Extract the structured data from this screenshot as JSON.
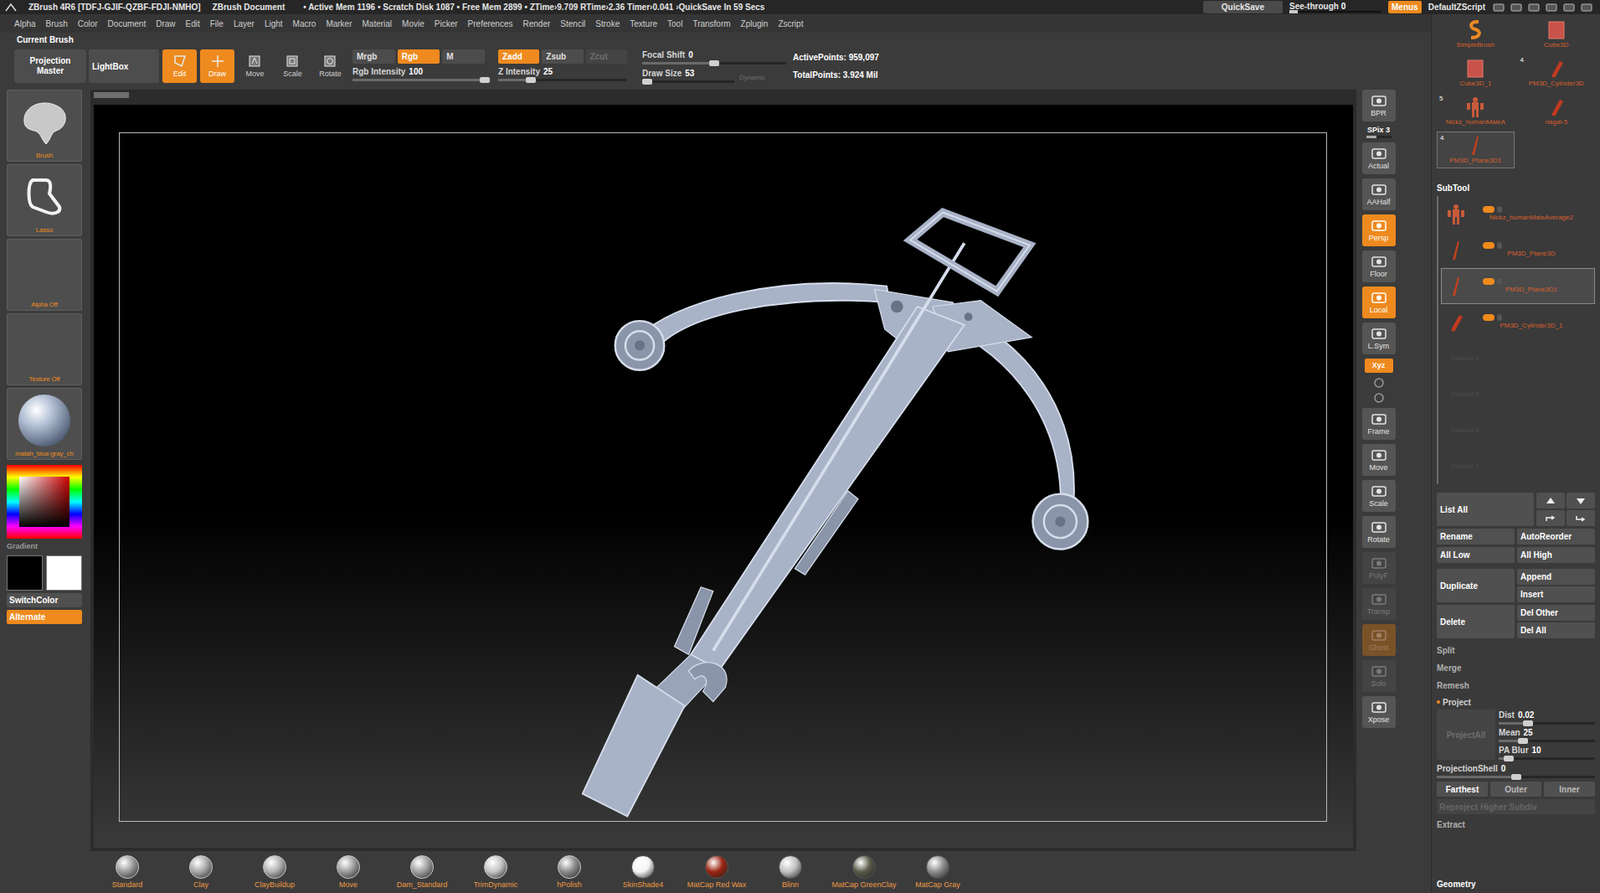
{
  "title_bar": {
    "app": "ZBrush 4R6 [TDFJ-GJIF-QZBF-FDJI-NMHO]",
    "document": "ZBrush Document",
    "stats": "• Active Mem 1196 • Scratch Disk 1087 • Free Mem 2899 • ZTime›9.709 RTime›2.36 Timer›0.041 ›QuickSave In 59 Secs",
    "quicksave": "QuickSave",
    "see_through": {
      "label": "See-through",
      "value": "0",
      "level": 0
    },
    "menus": {
      "label": "Menus",
      "selected": true
    },
    "script": "DefaultZScript"
  },
  "menu_bar": [
    "Alpha",
    "Brush",
    "Color",
    "Document",
    "Draw",
    "Edit",
    "File",
    "Layer",
    "Light",
    "Macro",
    "Marker",
    "Material",
    "Movie",
    "Picker",
    "Preferences",
    "Render",
    "Stencil",
    "Stroke",
    "Texture",
    "Tool",
    "Transform",
    "Zplugin",
    "Zscript"
  ],
  "current_brush": "Current Brush",
  "toolbar": {
    "projection_master": "Projection Master",
    "lightbox": "LightBox",
    "modes": [
      {
        "label": "Edit",
        "kind": "edit",
        "selected": true
      },
      {
        "label": "Draw",
        "kind": "draw",
        "selected": true
      },
      {
        "label": "Move",
        "kind": "move",
        "selected": false
      },
      {
        "label": "Scale",
        "kind": "scale",
        "selected": false
      },
      {
        "label": "Rotate",
        "kind": "rotate",
        "selected": false
      }
    ],
    "color_modes": [
      {
        "label": "Mrgb",
        "selected": false,
        "disabled": false
      },
      {
        "label": "Rgb",
        "selected": true,
        "disabled": false
      },
      {
        "label": "M",
        "selected": false,
        "disabled": false
      }
    ],
    "z_modes": [
      {
        "label": "Zadd",
        "selected": true,
        "disabled": false
      },
      {
        "label": "Zsub",
        "selected": false,
        "disabled": false
      },
      {
        "label": "Zcut",
        "selected": false,
        "disabled": true
      }
    ],
    "rgb_intensity": {
      "label": "Rgb Intensity",
      "value": "100",
      "level": 1
    },
    "z_intensity": {
      "label": "Z Intensity",
      "value": "25",
      "level": 0.25
    },
    "focal_shift": {
      "label": "Focal Shift",
      "value": "0",
      "level": 0.5
    },
    "draw_size": {
      "label": "Draw Size",
      "value": "53",
      "level": 0.05
    },
    "dynamic": {
      "label": "Dynamic",
      "selected": false
    },
    "active_points": "ActivePoints: 959,097",
    "total_points": "TotalPoints: 3.924 Mil"
  },
  "left_shelf": {
    "thumbnails": [
      {
        "label": "Brush",
        "kind": "brush"
      },
      {
        "label": "Lasso",
        "kind": "lasso"
      },
      {
        "label": "Alpha Off",
        "kind": "empty"
      },
      {
        "label": "Texture Off",
        "kind": "empty"
      },
      {
        "label": "matah_blue-gray_ch",
        "kind": "material"
      }
    ],
    "gradient": "Gradient",
    "swatches": [
      {
        "name": "secondary",
        "color": "#000000"
      },
      {
        "name": "main",
        "color": "#ffffff"
      }
    ],
    "switch_color": "SwitchColor",
    "alternate": {
      "label": "Alternate",
      "selected": true
    }
  },
  "right_toolbar": [
    {
      "label": "BPR",
      "kind": "button",
      "selected": false,
      "disabled": false
    },
    {
      "label": "SPix",
      "value": "3",
      "level": 0.4,
      "kind": "slider",
      "selected": false,
      "disabled": false
    },
    {
      "label": "Actual",
      "kind": "button",
      "selected": false,
      "disabled": false
    },
    {
      "label": "AAHalf",
      "kind": "button",
      "selected": false,
      "disabled": false
    },
    {
      "label": "Persp",
      "kind": "button",
      "selected": true,
      "disabled": false
    },
    {
      "label": "Floor",
      "kind": "button",
      "selected": false,
      "disabled": false
    },
    {
      "label": "Local",
      "kind": "button",
      "selected": true,
      "disabled": false
    },
    {
      "label": "L.Sym",
      "kind": "button",
      "selected": false,
      "disabled": false
    },
    {
      "label": "Xyz",
      "kind": "chip",
      "selected": true,
      "disabled": false
    },
    {
      "label": "Frame",
      "kind": "button",
      "selected": false,
      "disabled": false
    },
    {
      "label": "Move",
      "kind": "button",
      "selected": false,
      "disabled": false
    },
    {
      "label": "Scale",
      "kind": "button",
      "selected": false,
      "disabled": false
    },
    {
      "label": "Rotate",
      "kind": "button",
      "selected": false,
      "disabled": false
    },
    {
      "label": "PolyF",
      "kind": "button",
      "selected": false,
      "disabled": true
    },
    {
      "label": "Transp",
      "kind": "button",
      "selected": false,
      "disabled": true
    },
    {
      "label": "Ghost",
      "kind": "button",
      "selected": true,
      "disabled": true
    },
    {
      "label": "Solo",
      "kind": "button",
      "selected": false,
      "disabled": true
    },
    {
      "label": "Xpose",
      "kind": "button",
      "selected": false,
      "disabled": false
    }
  ],
  "tool_palette": [
    {
      "label": "SimpleBrush",
      "kind": "brush",
      "selected": false
    },
    {
      "label": "Cube3D",
      "kind": "cube",
      "selected": false
    },
    {
      "label": "Cube3D_1",
      "kind": "cube",
      "selected": false
    },
    {
      "label": "PM3D_Cylinder3D",
      "kind": "cylinder",
      "count": "4",
      "selected": false
    },
    {
      "label": "Nickz_humanMaleA",
      "kind": "figure",
      "count": "5",
      "selected": false
    },
    {
      "label": "nagai-5",
      "kind": "cylinder",
      "selected": false
    },
    {
      "label": "PM3D_Plane3D1",
      "kind": "plane",
      "count": "4",
      "selected": true
    }
  ],
  "subtool": {
    "title": "SubTool",
    "items": [
      {
        "name": "Nickz_humanMaleAverage2",
        "kind": "figure",
        "visible": true,
        "selected": false
      },
      {
        "name": "PM3D_Plane3D",
        "kind": "plane",
        "visible": true,
        "selected": false
      },
      {
        "name": "PM3D_Plane3D1",
        "kind": "plane",
        "visible": true,
        "selected": true
      },
      {
        "name": "PM3D_Cylinder3D_1",
        "kind": "cylinder",
        "visible": true,
        "selected": false
      }
    ],
    "empty_slots": [
      "Subtool 4",
      "Subtool 5",
      "Subtool 6",
      "Subtool 7"
    ],
    "list_all": "List All",
    "rename": "Rename",
    "auto_reorder": "AutoReorder",
    "all_low": "All Low",
    "all_high": "All High",
    "duplicate": "Duplicate",
    "append": "Append",
    "insert": "Insert",
    "delete": "Delete",
    "del_other": "Del Other",
    "del_all": "Del All",
    "sections": [
      "Split",
      "Merge",
      "Remesh"
    ],
    "project": {
      "label": "Project",
      "expanded": true,
      "project_all": {
        "label": "ProjectAll",
        "disabled": true
      },
      "sliders": [
        {
          "label": "Dist",
          "value": "0.02",
          "level": 0.3
        },
        {
          "label": "Mean",
          "value": "25",
          "level": 0.25
        },
        {
          "label": "PA Blur",
          "value": "10",
          "level": 0.1
        }
      ],
      "projection_shell": {
        "label": "ProjectionShell",
        "value": "0",
        "level": 0.5
      },
      "shell_modes": [
        {
          "label": "Farthest",
          "selected": true
        },
        {
          "label": "Outer",
          "selected": false
        },
        {
          "label": "Inner",
          "selected": false
        }
      ],
      "reproject": {
        "label": "Reproject Higher Subdiv",
        "disabled": true
      }
    },
    "extract": "Extract",
    "geometry": "Geometry"
  },
  "bottom_shelf": [
    {
      "label": "Standard",
      "kind": "brush",
      "color": "#9a9a9a"
    },
    {
      "label": "Clay",
      "kind": "brush",
      "color": "#a8a8a8"
    },
    {
      "label": "ClayBuildup",
      "kind": "brush",
      "color": "#b0b0b0"
    },
    {
      "label": "Move",
      "kind": "brush",
      "color": "#9c9c9c"
    },
    {
      "label": "Dam_Standard",
      "kind": "brush",
      "color": "#a0a0a0"
    },
    {
      "label": "TrimDynamic",
      "kind": "brush",
      "color": "#c4c4c4"
    },
    {
      "label": "hPolish",
      "kind": "brush",
      "color": "#8a8a8a"
    },
    {
      "label": "SkinShade4",
      "kind": "material",
      "color": "#f4f4f4"
    },
    {
      "label": "MatCap Red Wax",
      "kind": "material",
      "color": "#9a2410"
    },
    {
      "label": "Blinn",
      "kind": "material",
      "color": "#c0c0c0"
    },
    {
      "label": "MatCap GreenClay",
      "kind": "material",
      "color": "#5a5a48"
    },
    {
      "label": "MatCap Gray",
      "kind": "material",
      "color": "#8c8c8c"
    }
  ]
}
